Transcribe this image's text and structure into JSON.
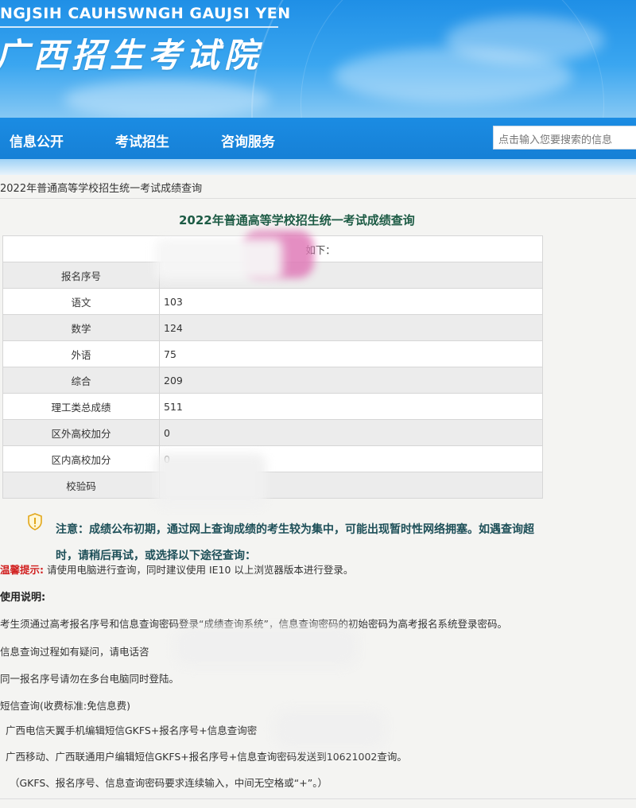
{
  "header": {
    "subtitle": "NGJSIH CAUHSWNGH GAUJSI YEN",
    "title": "广西招生考试院"
  },
  "nav": {
    "items": [
      "信息公开",
      "考试招生",
      "咨询服务"
    ],
    "search_placeholder": "点击输入您要搜索的信息"
  },
  "breadcrumb": "2022年普通高等学校招生统一考试成绩查询",
  "page_title": "2022年普通高等学校招生统一考试成绩查询",
  "table": {
    "header_fragment": "如下：",
    "rows": [
      {
        "label": "报名序号",
        "value": ""
      },
      {
        "label": "语文",
        "value": "103"
      },
      {
        "label": "数学",
        "value": "124"
      },
      {
        "label": "外语",
        "value": "75"
      },
      {
        "label": "综合",
        "value": "209"
      },
      {
        "label": "理工类总成绩",
        "value": "511"
      },
      {
        "label": "区外高校加分",
        "value": "0"
      },
      {
        "label": "区内高校加分",
        "value": "0"
      },
      {
        "label": "校验码",
        "value": ""
      }
    ]
  },
  "notice": {
    "text": "注意：成绩公布初期，通过网上查询成绩的考生较为集中，可能出现暂时性网络拥塞。如遇查询超时，请稍后再试，或选择以下途径查询："
  },
  "tip": {
    "label": "温馨提示:",
    "text": "请使用电脑进行查询，同时建议使用 IE10 以上浏览器版本进行登录。"
  },
  "usage": {
    "title": "使用说明:",
    "lines": [
      "考生须通过高考报名序号和信息查询密码登录“成绩查询系统”，信息查询密码的初始密码为高考报名系统登录密码。",
      "信息查询过程如有疑问，请电话咨",
      "同一报名序号请勿在多台电脑同时登陆。",
      "短信查询(收费标准:免信息费)",
      "广西电信天翼手机编辑短信GKFS+报名序号+信息查询密",
      "广西移动、广西联通用户编辑短信GKFS+报名序号+信息查询密码发送到10621002查询。",
      "（GKFS、报名序号、信息查询密码要求连续输入，中间无空格或“+”。）"
    ]
  },
  "colors": {
    "banner": "#1f8fe6",
    "nav": "#1680d6",
    "title_green": "#1d5b45",
    "tip_red": "#d12020",
    "notice_text": "#1d4f58"
  }
}
